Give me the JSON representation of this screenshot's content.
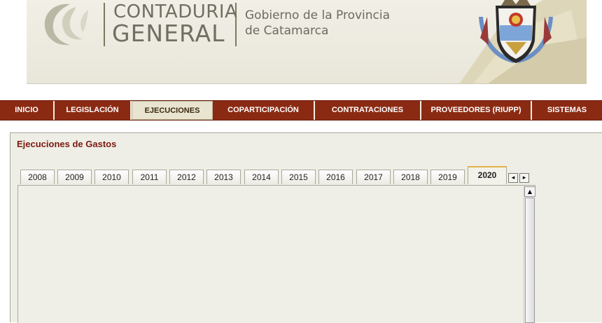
{
  "header": {
    "org_line1": "CONTADURIA",
    "org_line2": "GENERAL",
    "gov_line1": "Gobierno de la Provincia",
    "gov_line2": "de Catamarca"
  },
  "nav": {
    "items": [
      {
        "label": "INICIO"
      },
      {
        "label": "LEGISLACIÓN"
      },
      {
        "label": "EJECUCIONES"
      },
      {
        "label": "COPARTICIPACIÓN"
      },
      {
        "label": "CONTRATACIONES"
      },
      {
        "label": "PROVEEDORES (RIUPP)"
      },
      {
        "label": "SISTEMAS"
      }
    ],
    "active": "EJECUCIONES"
  },
  "panel": {
    "title": "Ejecuciones de Gastos",
    "tabs": [
      "2008",
      "2009",
      "2010",
      "2011",
      "2012",
      "2013",
      "2014",
      "2015",
      "2016",
      "2017",
      "2018",
      "2019",
      "2020"
    ],
    "active_tab": "2020",
    "scroll_left_glyph": "◂",
    "scroll_right_glyph": "▸",
    "vscroll_up_glyph": "▲"
  },
  "colors": {
    "nav_bg": "#8b2a13",
    "nav_active_bg": "#e9e4cf",
    "title_color": "#7a1a10",
    "active_tab_accent": "#e5b24a"
  },
  "icons": {
    "logo": "swoosh-logo-icon",
    "coat_of_arms": "catamarca-coat-of-arms-icon"
  }
}
